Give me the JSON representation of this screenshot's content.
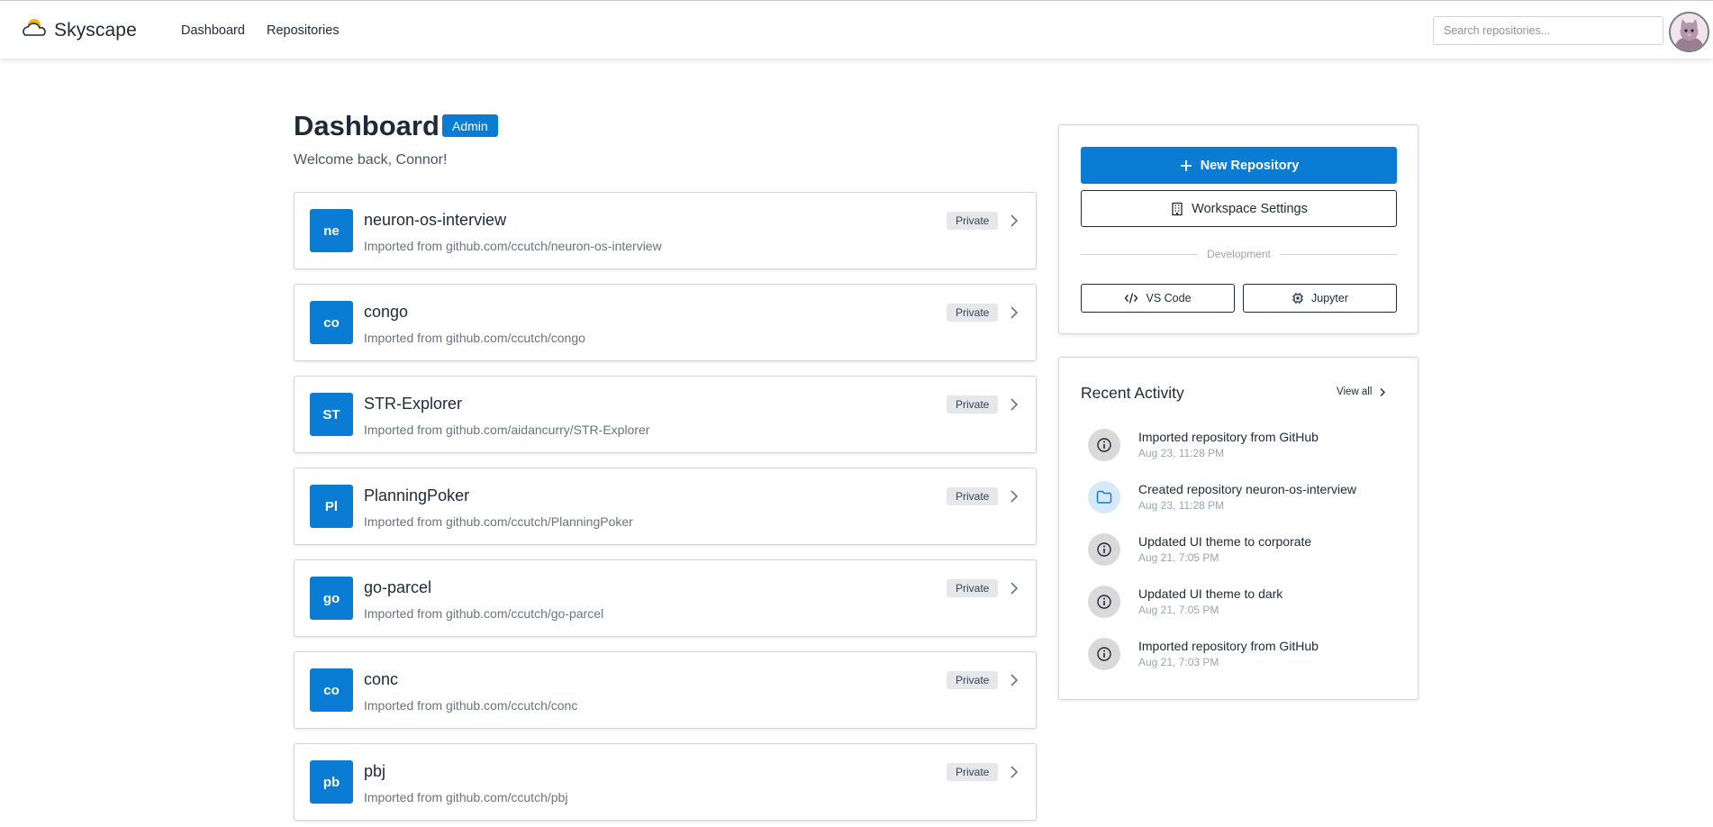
{
  "navbar": {
    "brand": "Skyscape",
    "links": [
      "Dashboard",
      "Repositories"
    ],
    "search_placeholder": "Search repositories..."
  },
  "header": {
    "title": "Dashboard",
    "badge": "Admin",
    "welcome": "Welcome back, Connor!"
  },
  "repositories": [
    {
      "initials": "ne",
      "name": "neuron-os-interview",
      "description": "Imported from github.com/ccutch/neuron-os-interview",
      "visibility": "Private"
    },
    {
      "initials": "co",
      "name": "congo",
      "description": "Imported from github.com/ccutch/congo",
      "visibility": "Private"
    },
    {
      "initials": "ST",
      "name": "STR-Explorer",
      "description": "Imported from github.com/aidancurry/STR-Explorer",
      "visibility": "Private"
    },
    {
      "initials": "Pl",
      "name": "PlanningPoker",
      "description": "Imported from github.com/ccutch/PlanningPoker",
      "visibility": "Private"
    },
    {
      "initials": "go",
      "name": "go-parcel",
      "description": "Imported from github.com/ccutch/go-parcel",
      "visibility": "Private"
    },
    {
      "initials": "co",
      "name": "conc",
      "description": "Imported from github.com/ccutch/conc",
      "visibility": "Private"
    },
    {
      "initials": "pb",
      "name": "pbj",
      "description": "Imported from github.com/ccutch/pbj",
      "visibility": "Private"
    }
  ],
  "actions": {
    "new_repository": "New Repository",
    "workspace_settings": "Workspace Settings",
    "section_label": "Development",
    "vscode": "VS Code",
    "jupyter": "Jupyter"
  },
  "activity": {
    "title": "Recent Activity",
    "view_all": "View all",
    "items": [
      {
        "text": "Imported repository from GitHub",
        "time": "Aug 23, 11:28 PM",
        "icon": "info-icon"
      },
      {
        "text": "Created repository neuron-os-interview",
        "time": "Aug 23, 11:28 PM",
        "icon": "folder-icon"
      },
      {
        "text": "Updated UI theme to corporate",
        "time": "Aug 21, 7:05 PM",
        "icon": "info-icon"
      },
      {
        "text": "Updated UI theme to dark",
        "time": "Aug 21, 7:05 PM",
        "icon": "info-icon"
      },
      {
        "text": "Imported repository from GitHub",
        "time": "Aug 21, 7:03 PM",
        "icon": "info-icon"
      }
    ]
  },
  "colors": {
    "accent": "#0b7cd4",
    "badge_gray": "#e5e7eb",
    "folder_bg": "#d6e9f8",
    "info_bg": "#d9d9d9"
  }
}
